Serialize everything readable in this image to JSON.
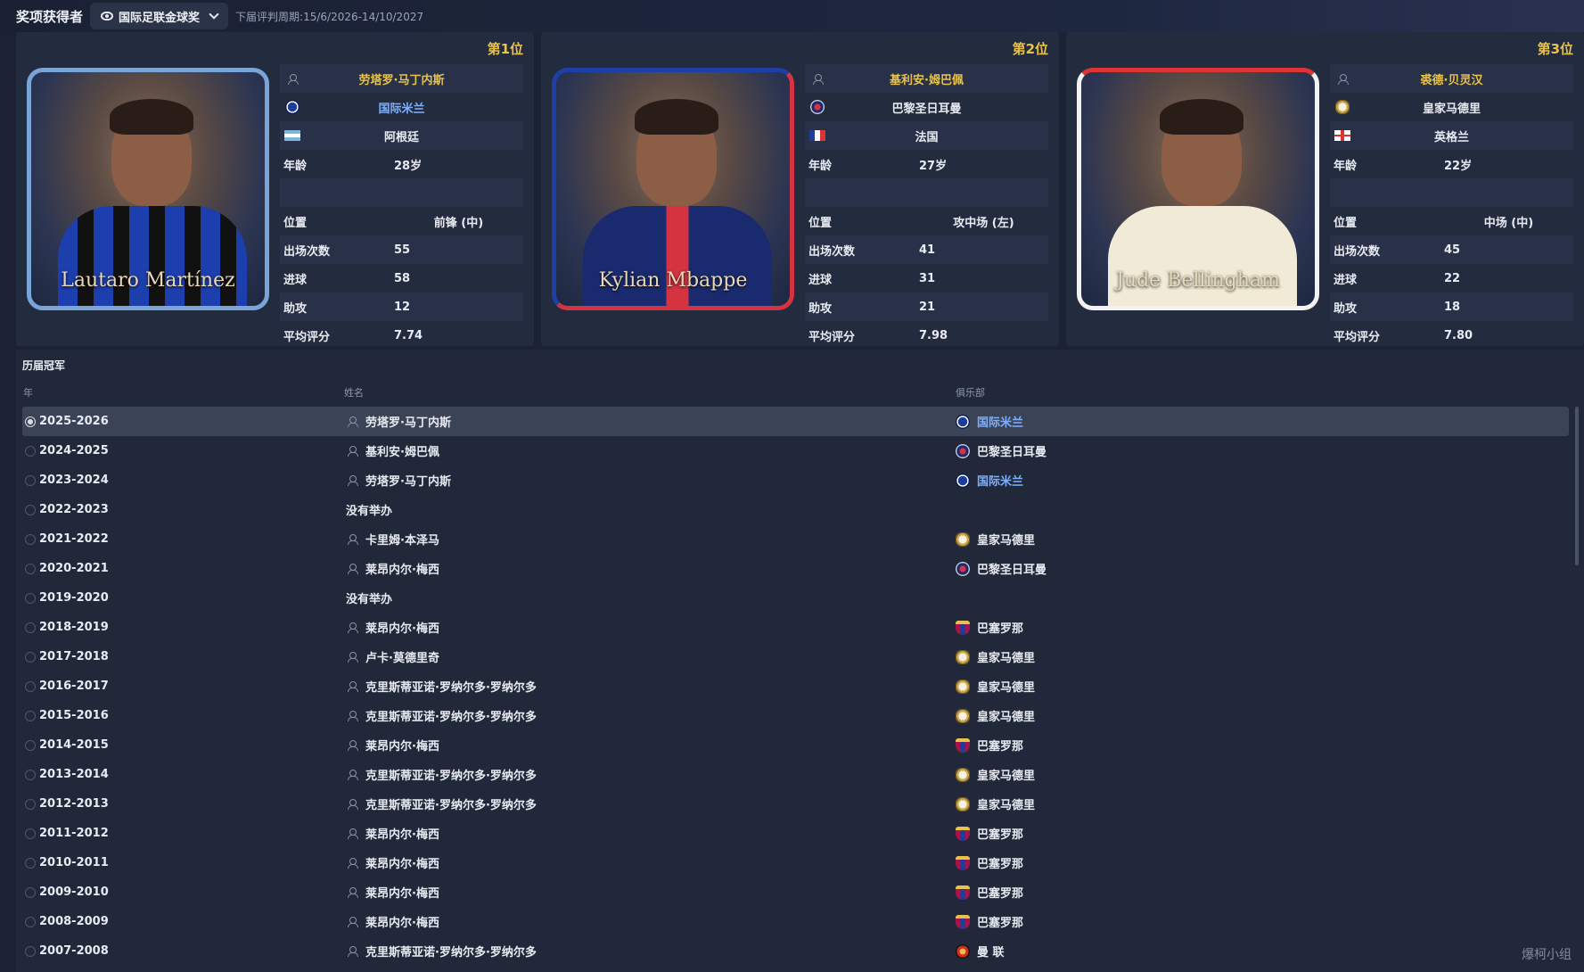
{
  "header": {
    "title": "奖项获得者",
    "award_selected": "国际足联金球奖",
    "period": "下届评判周期:15/6/2026-14/10/2027"
  },
  "cards": [
    {
      "rank": "第1位",
      "photo_name": "Lautaro Martínez",
      "name": "劳塔罗·马丁内斯",
      "club": "国际米兰",
      "club_icon": "inter-crest-icon",
      "nation": "阿根廷",
      "age_label": "年龄",
      "age": "28岁",
      "position_label": "位置",
      "position": "前锋 (中)",
      "apps_label": "出场次数",
      "apps": "55",
      "goals_label": "进球",
      "goals": "58",
      "assists_label": "助攻",
      "assists": "12",
      "rating_label": "平均评分",
      "rating": "7.74"
    },
    {
      "rank": "第2位",
      "photo_name": "Kylian Mbappe",
      "name": "基利安·姆巴佩",
      "club": "巴黎圣日耳曼",
      "club_icon": "psg-crest-icon",
      "nation": "法国",
      "age_label": "年龄",
      "age": "27岁",
      "position_label": "位置",
      "position": "攻中场 (左)",
      "apps_label": "出场次数",
      "apps": "41",
      "goals_label": "进球",
      "goals": "31",
      "assists_label": "助攻",
      "assists": "21",
      "rating_label": "平均评分",
      "rating": "7.98"
    },
    {
      "rank": "第3位",
      "photo_name": "Jude Bellingham",
      "name": "裘德·贝灵汉",
      "club": "皇家马德里",
      "club_icon": "real-madrid-crest-icon",
      "nation": "英格兰",
      "age_label": "年龄",
      "age": "22岁",
      "position_label": "位置",
      "position": "中场 (中)",
      "apps_label": "出场次数",
      "apps": "45",
      "goals_label": "进球",
      "goals": "22",
      "assists_label": "助攻",
      "assists": "18",
      "rating_label": "平均评分",
      "rating": "7.80"
    }
  ],
  "history": {
    "title": "历届冠军",
    "columns": {
      "year": "年",
      "name": "姓名",
      "club": "俱乐部"
    },
    "rows": [
      {
        "year": "2025-2026",
        "name": "劳塔罗·马丁内斯",
        "club": "国际米兰"
      },
      {
        "year": "2024-2025",
        "name": "基利安·姆巴佩",
        "club": "巴黎圣日耳曼"
      },
      {
        "year": "2023-2024",
        "name": "劳塔罗·马丁内斯",
        "club": "国际米兰"
      },
      {
        "year": "2022-2023",
        "name": "没有举办",
        "club": ""
      },
      {
        "year": "2021-2022",
        "name": "卡里姆·本泽马",
        "club": "皇家马德里"
      },
      {
        "year": "2020-2021",
        "name": "莱昂内尔·梅西",
        "club": "巴黎圣日耳曼"
      },
      {
        "year": "2019-2020",
        "name": "没有举办",
        "club": ""
      },
      {
        "year": "2018-2019",
        "name": "莱昂内尔·梅西",
        "club": "巴塞罗那"
      },
      {
        "year": "2017-2018",
        "name": "卢卡·莫德里奇",
        "club": "皇家马德里"
      },
      {
        "year": "2016-2017",
        "name": "克里斯蒂亚诺·罗纳尔多·罗纳尔多",
        "club": "皇家马德里"
      },
      {
        "year": "2015-2016",
        "name": "克里斯蒂亚诺·罗纳尔多·罗纳尔多",
        "club": "皇家马德里"
      },
      {
        "year": "2014-2015",
        "name": "莱昂内尔·梅西",
        "club": "巴塞罗那"
      },
      {
        "year": "2013-2014",
        "name": "克里斯蒂亚诺·罗纳尔多·罗纳尔多",
        "club": "皇家马德里"
      },
      {
        "year": "2012-2013",
        "name": "克里斯蒂亚诺·罗纳尔多·罗纳尔多",
        "club": "皇家马德里"
      },
      {
        "year": "2011-2012",
        "name": "莱昂内尔·梅西",
        "club": "巴塞罗那"
      },
      {
        "year": "2010-2011",
        "name": "莱昂内尔·梅西",
        "club": "巴塞罗那"
      },
      {
        "year": "2009-2010",
        "name": "莱昂内尔·梅西",
        "club": "巴塞罗那"
      },
      {
        "year": "2008-2009",
        "name": "莱昂内尔·梅西",
        "club": "巴塞罗那"
      },
      {
        "year": "2007-2008",
        "name": "克里斯蒂亚诺·罗纳尔多·罗纳尔多",
        "club": "曼 联"
      }
    ]
  },
  "watermark": "爆柯小组"
}
